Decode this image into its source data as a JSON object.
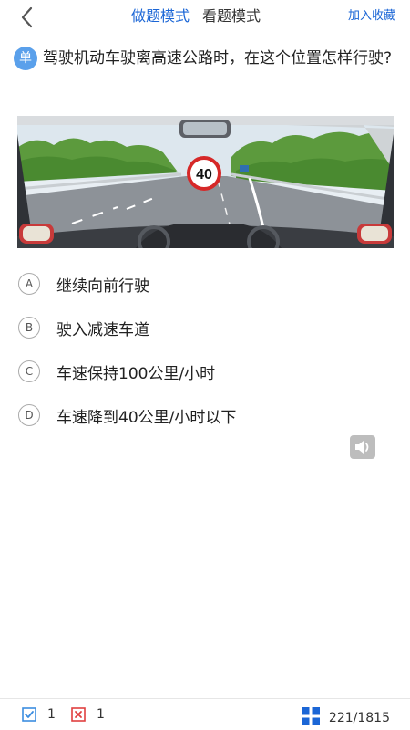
{
  "header": {
    "modes": [
      "做题模式",
      "看题模式"
    ],
    "active_mode": 0,
    "favorite_label": "加入收藏"
  },
  "question": {
    "type_badge": "单",
    "text": "驾驶机动车驶离高速公路时，在这个位置怎样行驶?",
    "scene_sign_text": "40"
  },
  "options": [
    {
      "letter": "A",
      "text": "继续向前行驶"
    },
    {
      "letter": "B",
      "text": "驶入减速车道"
    },
    {
      "letter": "C",
      "text": "车速保持100公里/小时"
    },
    {
      "letter": "D",
      "text": "车速降到40公里/小时以下"
    }
  ],
  "footer": {
    "correct_count": "1",
    "wrong_count": "1",
    "progress": "221/1815"
  },
  "colors": {
    "accent": "#1b66d6",
    "badge": "#5aa0eb",
    "correct": "#3c8de0",
    "wrong": "#e04040"
  },
  "icons": [
    "back-chevron-icon",
    "speaker-icon",
    "check-box-icon",
    "cross-box-icon",
    "grid-icon"
  ]
}
